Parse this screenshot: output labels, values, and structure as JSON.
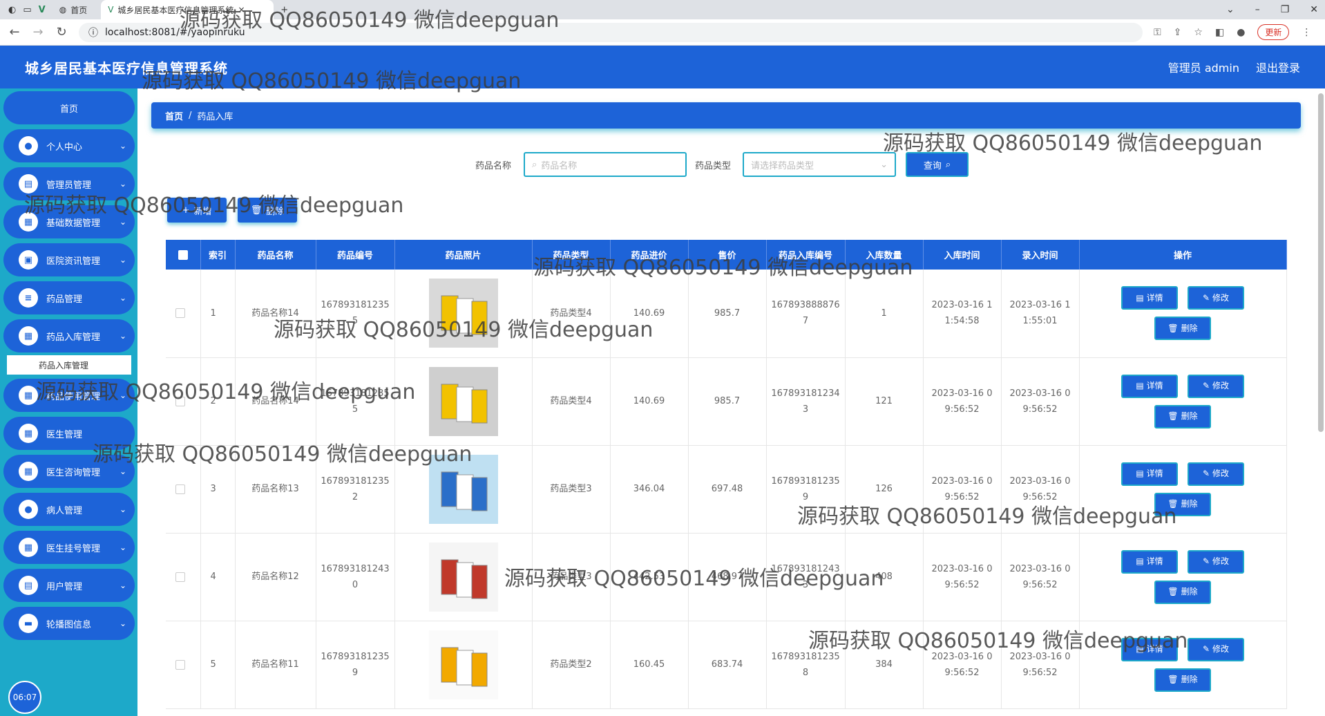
{
  "browser": {
    "tabs": [
      {
        "label": "首页"
      },
      {
        "label": "城乡居民基本医疗信息管理系统"
      }
    ],
    "active_tab_close": "×",
    "new_tab": "+",
    "url": "localhost:8081/#/yaopinruku",
    "update_label": "更新"
  },
  "header": {
    "title": "城乡居民基本医疗信息管理系统",
    "user": "管理员 admin",
    "logout": "退出登录"
  },
  "sidebar": {
    "home": "首页",
    "items": [
      {
        "label": "个人中心",
        "icon": "user-icon"
      },
      {
        "label": "管理员管理",
        "icon": "admin-icon"
      },
      {
        "label": "基础数据管理",
        "icon": "grid-icon"
      },
      {
        "label": "医院资讯管理",
        "icon": "news-icon"
      },
      {
        "label": "药品管理",
        "icon": "list-icon"
      },
      {
        "label": "药品入库管理",
        "icon": "grid-icon"
      }
    ],
    "sub_item": "药品入库管理",
    "items2": [
      {
        "label": "药品使用管理",
        "icon": "grid-icon"
      },
      {
        "label": "医生管理",
        "icon": "grid-icon"
      },
      {
        "label": "医生咨询管理",
        "icon": "grid-icon"
      },
      {
        "label": "病人管理",
        "icon": "user-icon"
      },
      {
        "label": "医生挂号管理",
        "icon": "grid-icon"
      },
      {
        "label": "用户管理",
        "icon": "admin-icon"
      },
      {
        "label": "轮播图信息",
        "icon": "briefcase-icon"
      }
    ],
    "clock": "06:07"
  },
  "breadcrumb": {
    "home": "首页",
    "separator": "/",
    "current": "药品入库"
  },
  "search": {
    "name_label": "药品名称",
    "name_placeholder": "药品名称",
    "type_label": "药品类型",
    "type_placeholder": "请选择药品类型",
    "query": "查询"
  },
  "actions": {
    "add": "新增",
    "delete": "删除"
  },
  "table": {
    "headers": [
      "索引",
      "药品名称",
      "药品编号",
      "药品照片",
      "药品类型",
      "药品进价",
      "售价",
      "药品入库编号",
      "入库数量",
      "入库时间",
      "录入时间",
      "操作"
    ],
    "rows": [
      {
        "index": "1",
        "name": "药品名称14",
        "code": "1678931812355",
        "type": "药品类型4",
        "cost": "140.69",
        "price": "985.7",
        "in_code": "1678938888767",
        "qty": "1",
        "in_time": "2023-03-16 11:54:58",
        "rec_time": "2023-03-16 11:55:01"
      },
      {
        "index": "2",
        "name": "药品名称14",
        "code": "1678931812355",
        "type": "药品类型4",
        "cost": "140.69",
        "price": "985.7",
        "in_code": "1678931812343",
        "qty": "121",
        "in_time": "2023-03-16 09:56:52",
        "rec_time": "2023-03-16 09:56:52"
      },
      {
        "index": "3",
        "name": "药品名称13",
        "code": "1678931812352",
        "type": "药品类型3",
        "cost": "346.04",
        "price": "697.48",
        "in_code": "1678931812359",
        "qty": "126",
        "in_time": "2023-03-16 09:56:52",
        "rec_time": "2023-03-16 09:56:52"
      },
      {
        "index": "4",
        "name": "药品名称12",
        "code": "1678931812430",
        "type": "药品类型3",
        "cost": "442.53",
        "price": "468.97",
        "in_code": "1678931812433",
        "qty": "408",
        "in_time": "2023-03-16 09:56:52",
        "rec_time": "2023-03-16 09:56:52"
      },
      {
        "index": "5",
        "name": "药品名称11",
        "code": "1678931812359",
        "type": "药品类型2",
        "cost": "160.45",
        "price": "683.74",
        "in_code": "1678931812358",
        "qty": "384",
        "in_time": "2023-03-16 09:56:52",
        "rec_time": "2023-03-16 09:56:52"
      }
    ],
    "op_detail": "详情",
    "op_edit": "修改",
    "op_delete": "删除"
  },
  "watermark": "源码获取 QQ86050149 微信deepguan",
  "colors": {
    "primary": "#1d63d8",
    "sidebar": "#1da9c9"
  }
}
